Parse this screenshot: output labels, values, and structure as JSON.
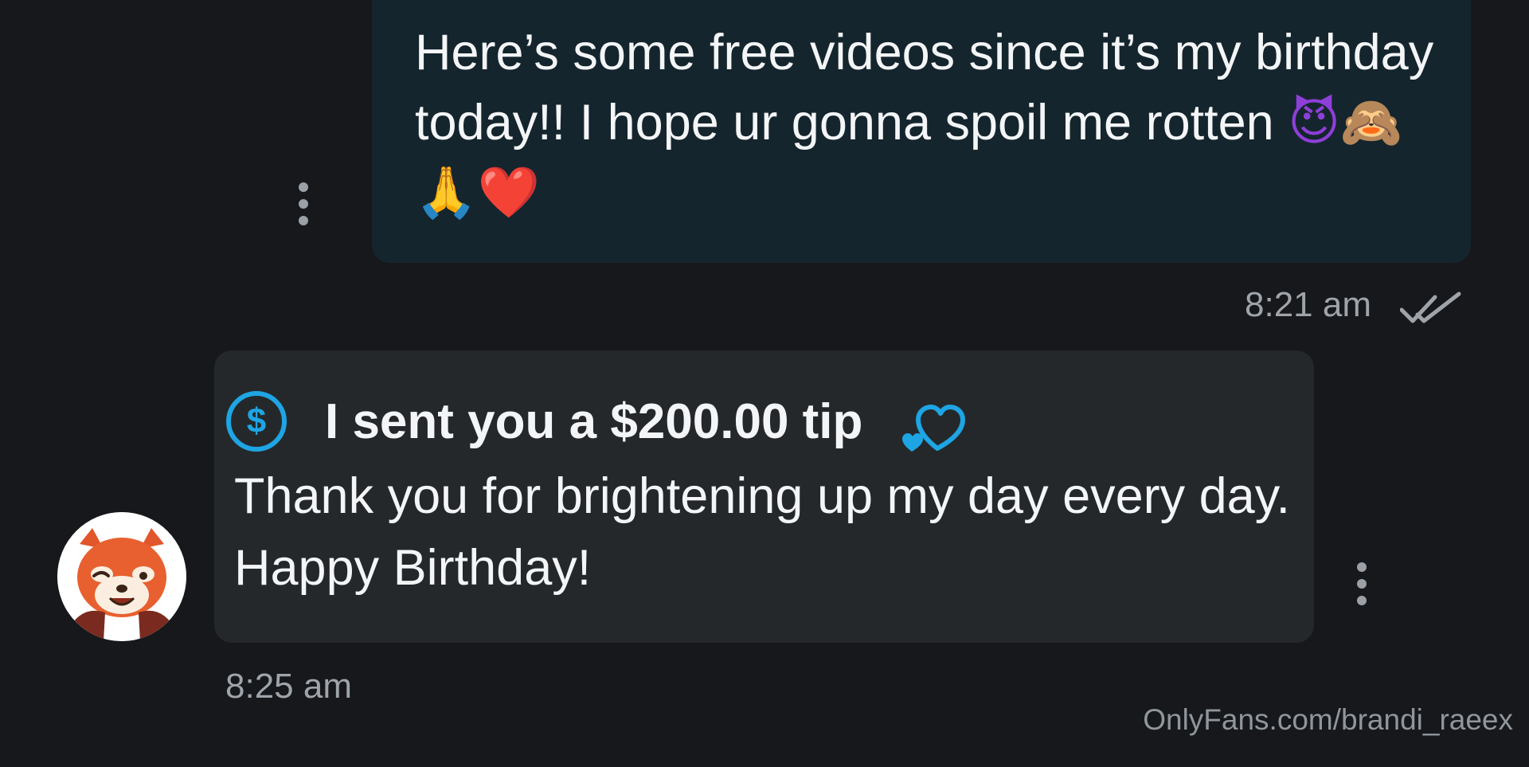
{
  "outgoing_message": {
    "text": "Here’s some free videos since it’s my birthday today!! I hope ur gonna spoil me rotten",
    "emojis": [
      "😈",
      "🙈",
      "🙏",
      "❤️"
    ],
    "time": "8:21 am",
    "status_icon": "double-check-icon"
  },
  "incoming_message": {
    "tip_text": "I sent you a $200.00 tip",
    "tip_icon": "dollar-circle-icon",
    "tip_symbol": "$",
    "reaction_icon": "two-hearts-icon",
    "body": "Thank you for brightening up my day every day. Happy Birthday!",
    "time": "8:25 am",
    "avatar_icon": "red-panda-avatar"
  },
  "watermark": "OnlyFans.com/brandi_raeex",
  "colors": {
    "background": "#16181b",
    "outgoing_bubble": "#15252d",
    "incoming_bubble": "#25282b",
    "accent": "#1ea5e3",
    "muted_text": "#9ea4aa"
  }
}
